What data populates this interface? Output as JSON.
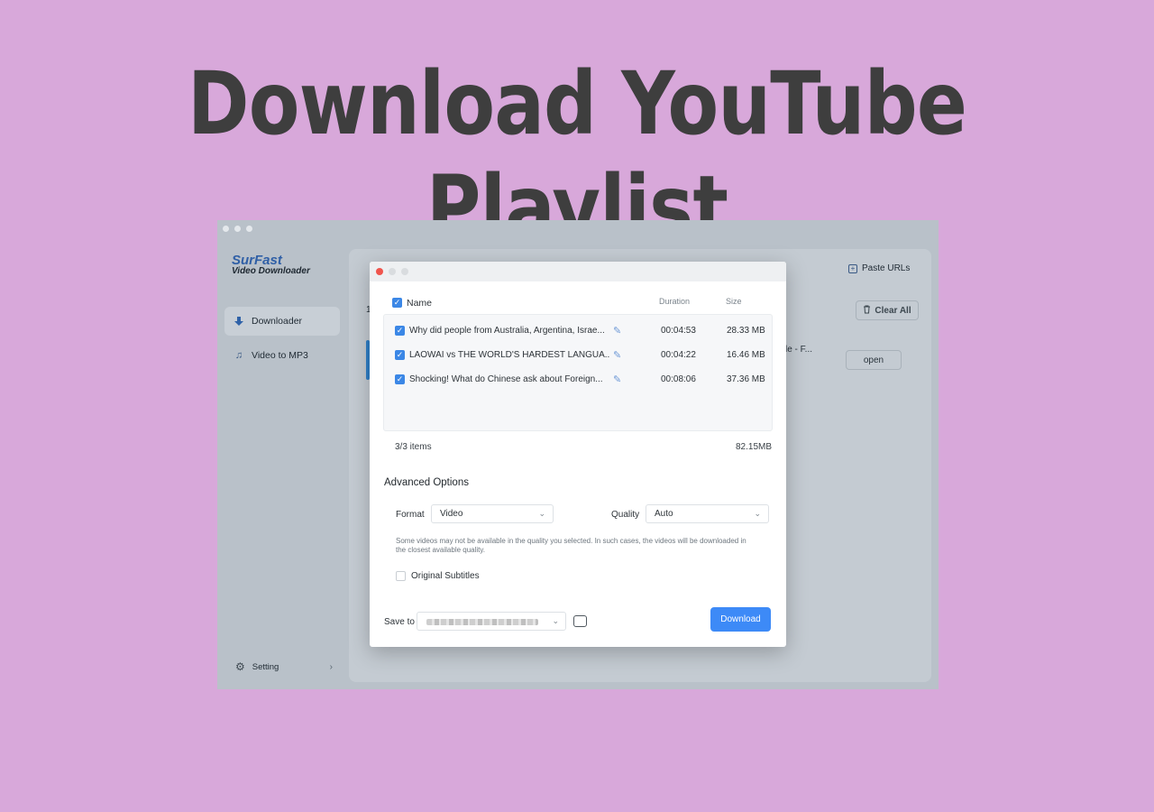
{
  "headline": "Download YouTube Playlist",
  "app": {
    "brand_line1": "SurFast",
    "brand_line2": "Video Downloader",
    "sidebar": [
      {
        "label": "Downloader",
        "icon": "download-arrow-icon",
        "active": true
      },
      {
        "label": "Video to MP3",
        "icon": "music-note-icon",
        "active": false
      }
    ],
    "setting_label": "Setting",
    "paste_urls_label": "Paste URLs",
    "clear_all_label": "Clear All",
    "open_label": "open",
    "bg_fragment": "le - F...",
    "bg_count": "1"
  },
  "dialog": {
    "col_name": "Name",
    "col_duration": "Duration",
    "col_size": "Size",
    "items": [
      {
        "name": "Why did people from Australia, Argentina, Israe...",
        "duration": "00:04:53",
        "size": "28.33 MB",
        "checked": true
      },
      {
        "name": "LAOWAI vs THE WORLD'S HARDEST LANGUA...",
        "duration": "00:04:22",
        "size": "16.46 MB",
        "checked": true
      },
      {
        "name": "Shocking! What do Chinese ask about Foreign...",
        "duration": "00:08:06",
        "size": "37.36 MB",
        "checked": true
      }
    ],
    "items_count": "3/3 items",
    "total_size": "82.15MB",
    "advanced_title": "Advanced Options",
    "format_label": "Format",
    "format_value": "Video",
    "quality_label": "Quality",
    "quality_value": "Auto",
    "note": "Some videos may not be available in the quality you selected. In such cases, the videos will be downloaded in the closest available quality.",
    "subtitles_label": "Original Subtitles",
    "subtitles_checked": false,
    "save_to_label": "Save to",
    "download_label": "Download"
  },
  "colors": {
    "page_background": "#d8a8da",
    "headline": "#3e3e3e",
    "accent": "#3d8af7",
    "close_dot": "#f0554d"
  }
}
